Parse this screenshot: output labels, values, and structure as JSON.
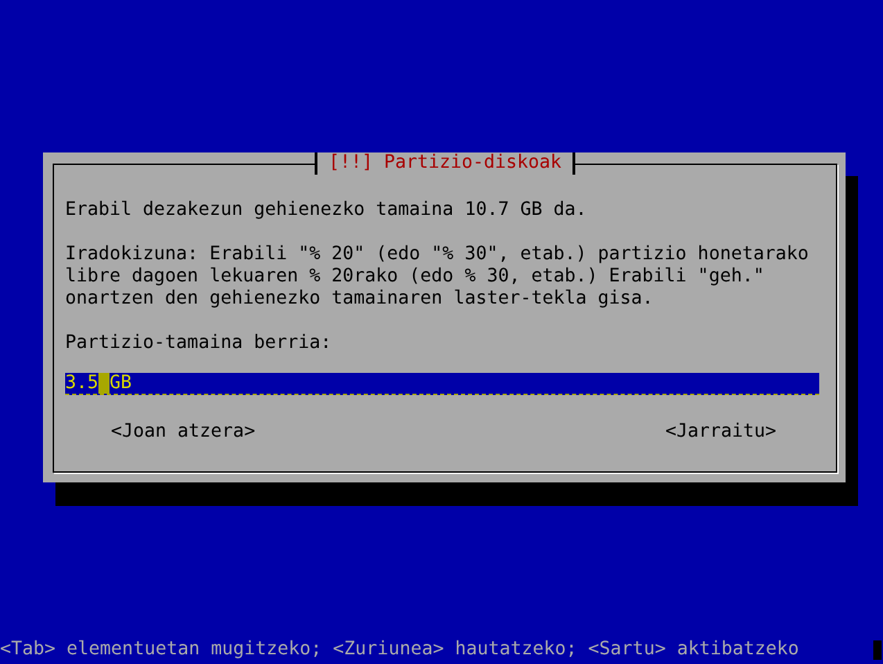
{
  "dialog": {
    "title": "[!!] Partizio-diskoak",
    "paragraphs": [
      "Erabil dezakezun gehienezko tamaina 10.7 GB da.",
      "Iradokizuna: Erabili \"% 20\" (edo \"% 30\", etab.) partizio honetarako libre dagoen lekuaren % 20rako (edo % 30, etab.) Erabili \"geh.\" onartzen den gehienezko tamainaren laster-tekla gisa."
    ],
    "field": {
      "label": "Partizio-tamaina berria:",
      "value": "3.5 GB",
      "focused": true
    },
    "buttons": [
      {
        "label": "<Joan atzera>",
        "selected": false
      },
      {
        "label": "<Jarraitu>",
        "selected": false
      }
    ]
  },
  "status_bar": "<Tab> elementuetan mugitzeko; <Zuriunea> hautatzeko; <Sartu> aktibatzeko"
}
